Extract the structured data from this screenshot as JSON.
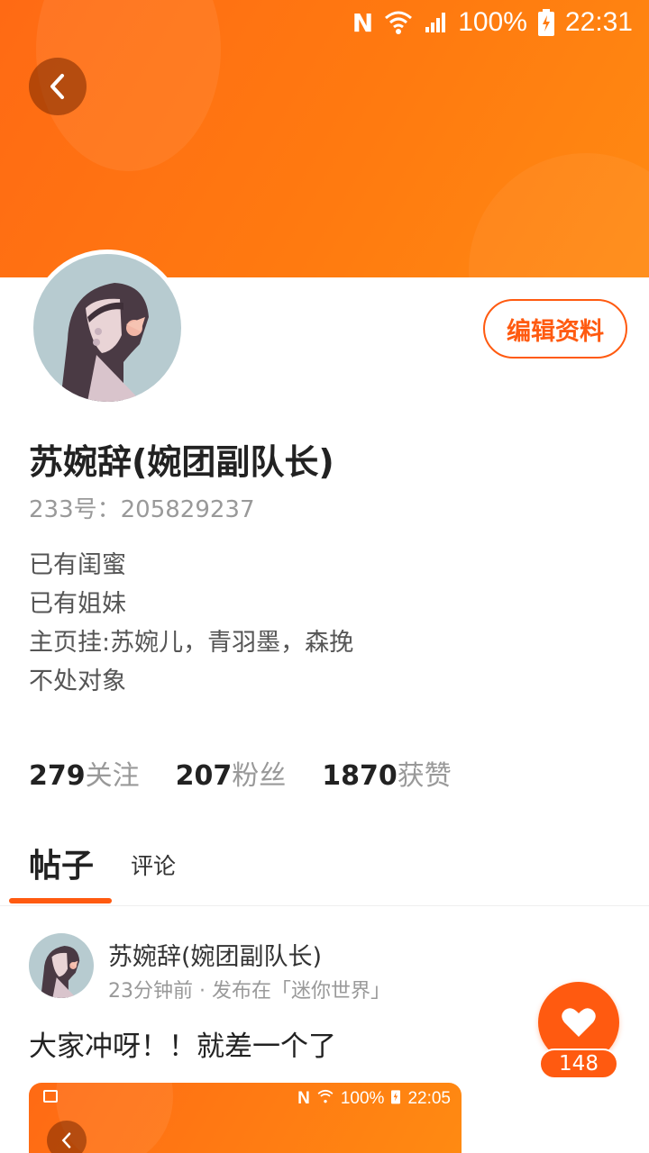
{
  "status_bar": {
    "network_letter": "N",
    "battery": "100%",
    "time": "22:31"
  },
  "profile": {
    "edit_button": "编辑资料",
    "name": "苏婉辞(婉团副队长)",
    "id_label": "233号：205829237",
    "bio": [
      "已有闺蜜",
      "已有姐妹",
      "主页挂:苏婉儿，青羽墨，森挽",
      "不处对象"
    ]
  },
  "stats": [
    {
      "value": "279",
      "label": "关注"
    },
    {
      "value": "207",
      "label": "粉丝"
    },
    {
      "value": "1870",
      "label": "获赞"
    }
  ],
  "tabs": {
    "posts": "帖子",
    "comments": "评论"
  },
  "post": {
    "author": "苏婉辞(婉团副队长)",
    "meta": "23分钟前 · 发布在「迷你世界」",
    "text": "大家冲呀！！就差一个了",
    "likes": "148",
    "image_status": {
      "network_letter": "N",
      "battery": "100%",
      "time": "22:05"
    }
  },
  "colors": {
    "accent": "#ff5a10",
    "header_gradient_start": "#ff6a14",
    "header_gradient_end": "#ff8a12"
  },
  "icons": [
    "back-arrow-icon",
    "wifi-icon",
    "signal-icon",
    "battery-icon",
    "heart-icon",
    "image-icon"
  ]
}
